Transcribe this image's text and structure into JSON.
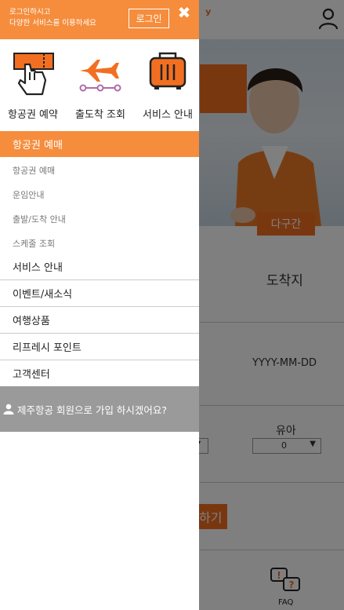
{
  "drawer": {
    "login_message": [
      "로그인하시고",
      "다양한 서비스를 이용하세요"
    ],
    "login_button": "로그인",
    "close_icon": "✖",
    "quick_links": [
      {
        "label": "항공권 예약",
        "icon": "ticket-hand-icon"
      },
      {
        "label": "출도착 조회",
        "icon": "airplane-route-icon"
      },
      {
        "label": "서비스 안내",
        "icon": "luggage-icon"
      }
    ],
    "active_menu": "항공권 예매",
    "sub_items": [
      "항공권 예매",
      "운임안내",
      "출발/도착 안내",
      "스케줄 조회"
    ],
    "main_items": [
      "서비스 안내",
      "이벤트/새소식",
      "여행상품",
      "리프레시 포인트",
      "고객센터"
    ],
    "join_prompt": "제주항공 회원으로 가입 하시겠어요?"
  },
  "background": {
    "tab_multi": "다구간",
    "arrival_label": "도착지",
    "date_placeholder": "YYYY-MM-DD",
    "infant_label": "유아",
    "infant_value": "0",
    "search_button": "하기",
    "faq_label": "FAQ"
  },
  "colors": {
    "accent": "#f58d3d",
    "brand": "#f26f21"
  }
}
